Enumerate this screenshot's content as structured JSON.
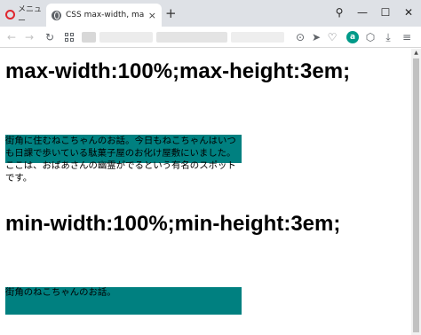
{
  "browser": {
    "tabs": [
      {
        "label": "メニュー",
        "icon": "opera-logo-icon"
      },
      {
        "label": "CSS max-width, max-heigh",
        "icon": "globe-icon",
        "active": true
      }
    ],
    "close_glyph": "×",
    "new_tab_glyph": "+",
    "window": {
      "search": "⚲",
      "minimize": "—",
      "maximize": "☐",
      "close": "✕"
    },
    "toolbar": {
      "back": "←",
      "forward": "→",
      "reload": "↻",
      "camera": "⊙",
      "send": "➤",
      "heart": "♡",
      "ext_a": "a",
      "cube": "⬡",
      "download": "⤓",
      "menu": "≡"
    }
  },
  "page": {
    "heading1": "max-width:100%;max-height:3em;",
    "box1_lines": [
      "街角に住むねこちゃんのお話。今日もねこちゃんはいつ",
      "も日課で歩いている駄菓子屋のお化け屋敷にいました。",
      "ここは、おばあさんの幽霊がでるという有名のスポット",
      "です。"
    ],
    "heading2": "min-width:100%;min-height:3em;",
    "box2_text": "街角のねこちゃんのお話。"
  },
  "colors": {
    "teal_box": "#008080",
    "tabbar_bg": "#dee1e6",
    "opera_red": "#e0262e",
    "ext_green": "#009a89"
  }
}
